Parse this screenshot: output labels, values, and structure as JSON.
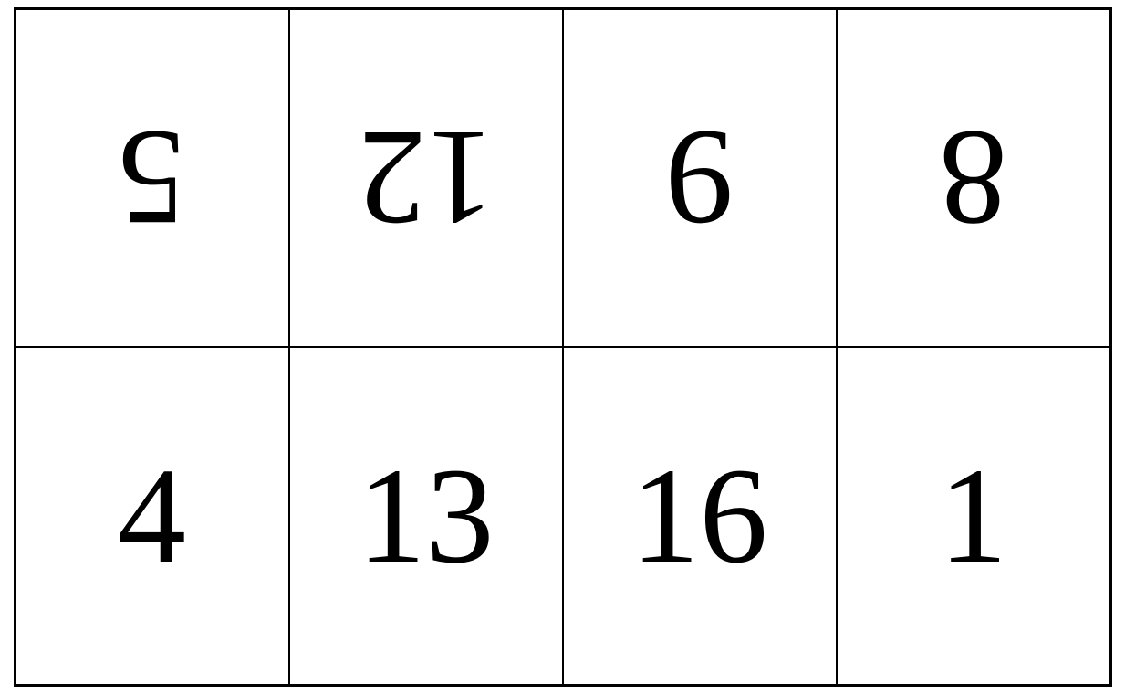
{
  "grid": {
    "rows": [
      {
        "rotated": true,
        "cells": [
          "5",
          "12",
          "9",
          "8"
        ]
      },
      {
        "rotated": false,
        "cells": [
          "4",
          "13",
          "16",
          "1"
        ]
      }
    ]
  }
}
